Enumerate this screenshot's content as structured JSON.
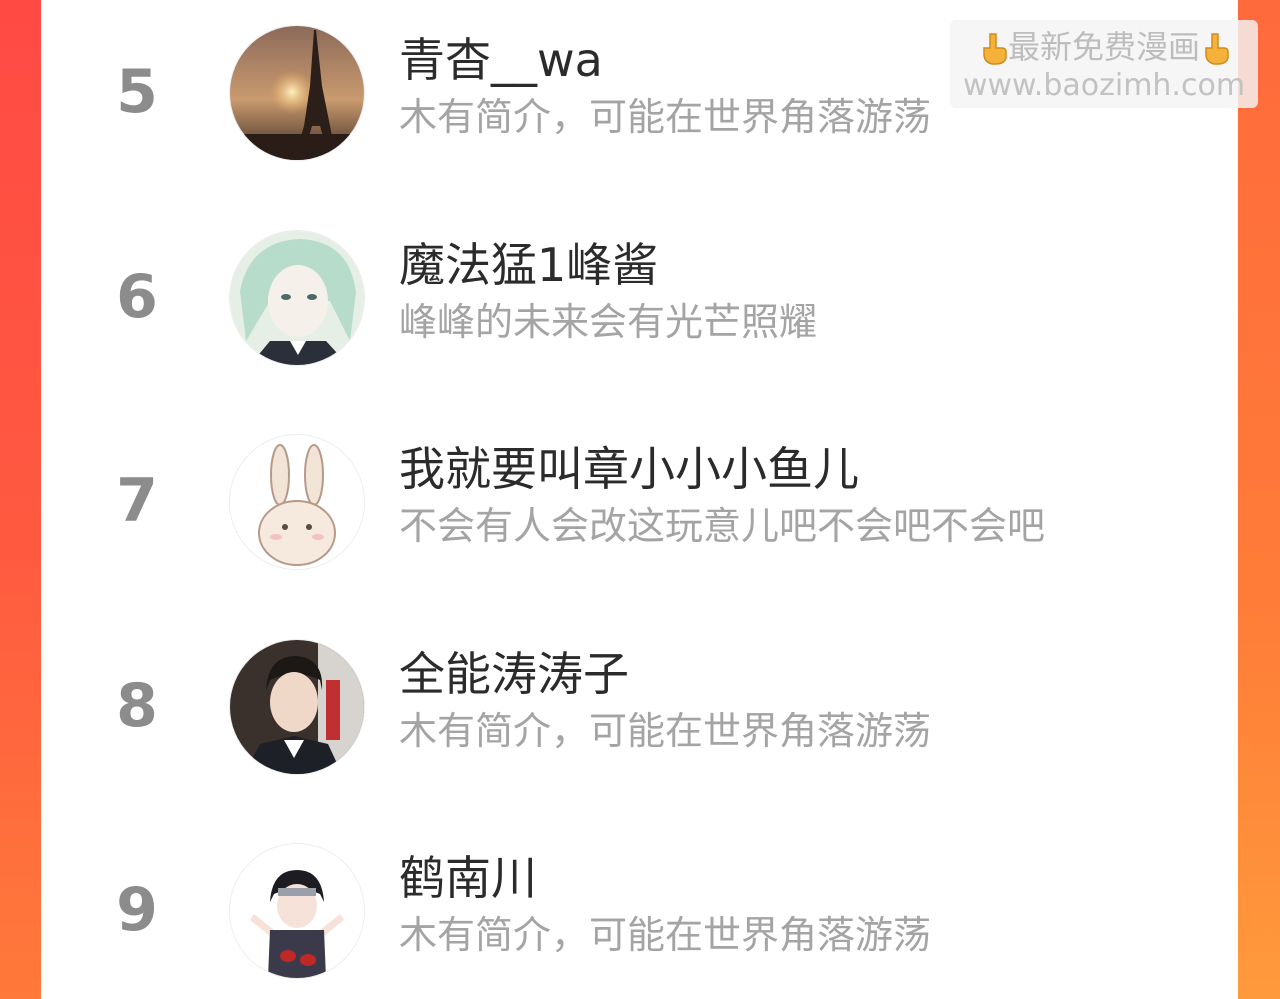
{
  "watermark": {
    "title": "最新免费漫画",
    "url": "www.baozimh.com",
    "icon": "pointing-down-hand-icon"
  },
  "ranking": [
    {
      "rank": "5",
      "name": "青杳__wa",
      "bio": "木有简介，可能在世界角落游荡",
      "avatar": "eiffel-tower-sunset-avatar"
    },
    {
      "rank": "6",
      "name": "魔法猛1峰酱",
      "bio": "峰峰的未来会有光芒照耀",
      "avatar": "anime-character-avatar"
    },
    {
      "rank": "7",
      "name": "我就要叫章小小小鱼儿",
      "bio": "不会有人会改这玩意儿吧不会吧不会吧",
      "avatar": "bunny-avatar"
    },
    {
      "rank": "8",
      "name": "全能涛涛子",
      "bio": "木有简介，可能在世界角落游荡",
      "avatar": "portrait-photo-avatar"
    },
    {
      "rank": "9",
      "name": "鹤南川",
      "bio": "木有简介，可能在世界角落游荡",
      "avatar": "chibi-ninja-avatar"
    }
  ]
}
